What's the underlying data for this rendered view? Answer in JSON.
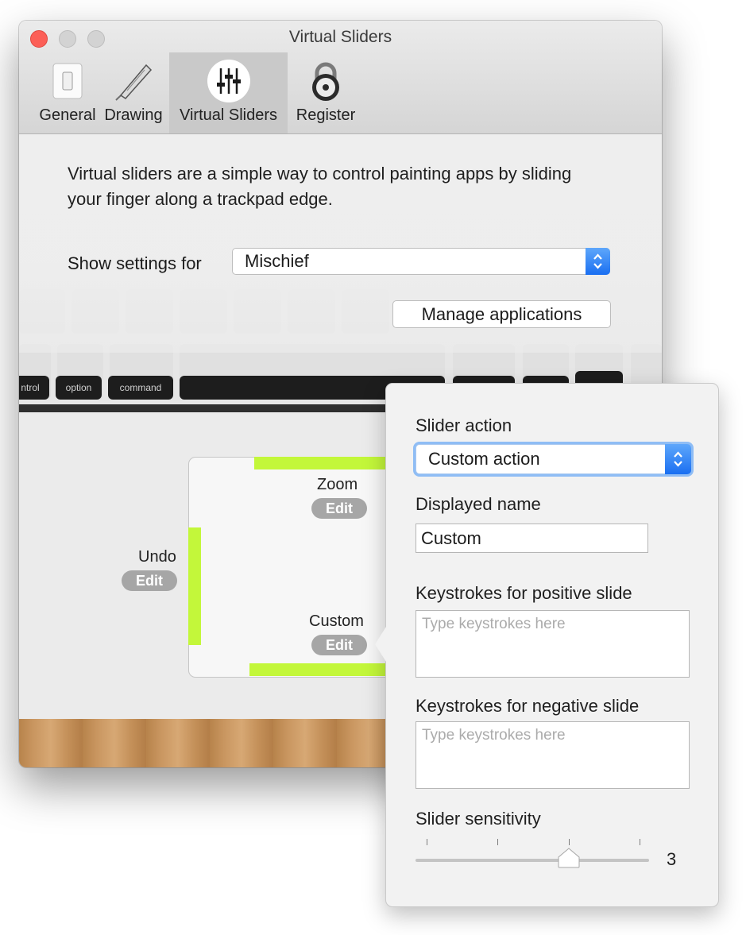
{
  "window": {
    "title": "Virtual Sliders",
    "controls": [
      "close",
      "minimize",
      "zoom"
    ],
    "tabs": [
      {
        "label": "General",
        "icon": "light-switch-icon",
        "active": false
      },
      {
        "label": "Drawing",
        "icon": "pen-icon",
        "active": false
      },
      {
        "label": "Virtual Sliders",
        "icon": "sliders-icon",
        "active": true
      },
      {
        "label": "Register",
        "icon": "padlock-icon",
        "active": false
      }
    ]
  },
  "content": {
    "intro": "Virtual sliders are a simple way to control painting apps by sliding your finger along a trackpad edge.",
    "show_settings_label": "Show settings for",
    "show_settings_value": "Mischief",
    "manage_button": "Manage applications",
    "keyboard_keys": {
      "left": "ntrol",
      "option": "option",
      "command": "command"
    }
  },
  "trackpad": {
    "sliders": [
      {
        "name": "Zoom",
        "edit": "Edit",
        "edge": "top"
      },
      {
        "name": "Undo",
        "edit": "Edit",
        "edge": "left"
      },
      {
        "name": "Custom",
        "edit": "Edit",
        "edge": "bottom"
      }
    ],
    "accent_color": "#c3f73a"
  },
  "popover": {
    "action_label": "Slider action",
    "action_value": "Custom action",
    "name_label": "Displayed name",
    "name_value": "Custom",
    "positive_label": "Keystrokes for positive slide",
    "positive_placeholder": "Type keystrokes here",
    "negative_label": "Keystrokes for negative slide",
    "negative_placeholder": "Type keystrokes here",
    "sensitivity_label": "Slider sensitivity",
    "sensitivity_value": "3",
    "sensitivity_min": 1,
    "sensitivity_max": 4
  }
}
